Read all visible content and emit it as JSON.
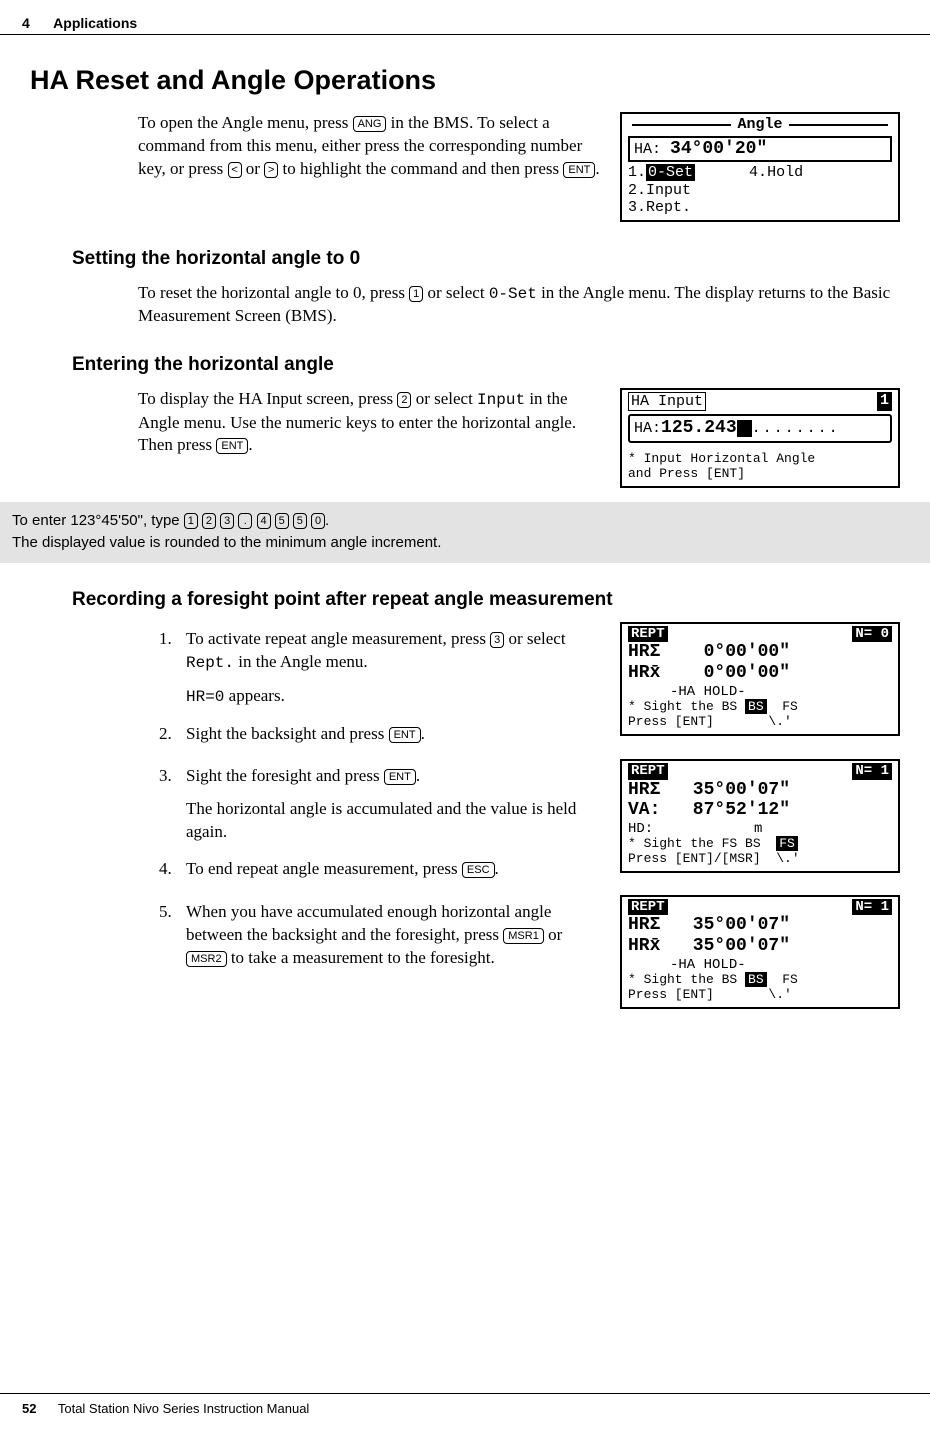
{
  "header": {
    "chapter_num": "4",
    "chapter_title": "Applications"
  },
  "footer": {
    "page_num": "52",
    "manual_title": "Total Station Nivo Series Instruction Manual"
  },
  "h1": "HA Reset and Angle Operations",
  "intro": {
    "t1": "To open the Angle menu, press ",
    "k_ang": "ANG",
    "t2": " in the BMS. To select a command from this menu, either press the corresponding number key, or press ",
    "k_left": "<",
    "t3": " or ",
    "k_right": ">",
    "t4": " to highlight the command and then press ",
    "k_ent": "ENT",
    "t5": "."
  },
  "lcd_angle": {
    "title": "Angle",
    "ha_label": "HA:",
    "ha_value": "34°00'20\"",
    "m1_num": "1.",
    "m1": "0-Set",
    "m4_num": "4.",
    "m4": "Hold",
    "m2_num": "2.",
    "m2": "Input",
    "m3_num": "3.",
    "m3": "Rept."
  },
  "sec1": {
    "h": "Setting the horizontal angle to 0",
    "p1a": "To reset the horizontal angle to 0, press ",
    "k1": "1",
    "p1b": " or select ",
    "mono": "0-Set",
    "p1c": " in the Angle menu. The display returns to the Basic Measurement Screen (BMS)."
  },
  "sec2": {
    "h": "Entering the horizontal angle",
    "p1a": "To display the HA Input screen, press ",
    "k2": "2",
    "p1b": " or select ",
    "mono": "Input",
    "p1c": " in the Angle menu. Use the numeric keys to enter the horizontal angle. Then press ",
    "k_ent": "ENT",
    "p1d": "."
  },
  "lcd_input": {
    "title": "HA Input",
    "corner": "1",
    "ha_label": "HA:",
    "ha_value": "125.243",
    "hint1": "* Input Horizontal Angle",
    "hint2": "  and Press [ENT]"
  },
  "note": {
    "line1a": "To enter 123°45'50\", type ",
    "keys": [
      "1",
      "2",
      "3",
      ".",
      "4",
      "5",
      "5",
      "0"
    ],
    "line1b": ".",
    "line2": "The displayed value is rounded to the minimum angle increment."
  },
  "sec3": {
    "h": "Recording a foresight point after repeat angle measurement",
    "step1a": "To activate repeat angle measurement, press ",
    "k3": "3",
    "step1b": " or select ",
    "mono_rept": "Rept.",
    "step1c": " in the Angle menu.",
    "step1_mono": "HR=0",
    "step1_appears": " appears.",
    "step2a": "Sight the backsight and press ",
    "k_ent": "ENT",
    "step2b": ".",
    "step3a": "Sight the foresight and press ",
    "step3b": ".",
    "step3c": "The horizontal angle is accumulated and the value is held again.",
    "step4a": "To end repeat angle measurement, press ",
    "k_esc": "ESC",
    "step4b": ".",
    "step5a": "When you have accumulated enough horizontal angle between the backsight and the foresight, press ",
    "k_msr1": "MSR1",
    "step5b": " or ",
    "k_msr2": "MSR2",
    "step5c": " to take a measurement to the foresight."
  },
  "lcd_rept1": {
    "top_left": "REPT",
    "top_right": "N= 0",
    "l1": "HRΣ    0°00'00\"",
    "l2": "HRx̄    0°00'00\"",
    "l3": "     -HA HOLD-",
    "hint1": "* Sight the BS   ",
    "bs": "BS",
    "fs": "FS",
    "hint2": "  Press [ENT]"
  },
  "lcd_rept2": {
    "top_left": "REPT",
    "top_right": "N= 1",
    "l1": "HRΣ   35°00'07\"",
    "l2": "VA:   87°52'12\"",
    "l3": "HD:            m",
    "hint1": "* Sight the FS   ",
    "bs": "BS",
    "fs": "FS",
    "hint2": "  Press [ENT]/[MSR]"
  },
  "lcd_rept3": {
    "top_left": "REPT",
    "top_right": "N= 1",
    "l1": "HRΣ   35°00'07\"",
    "l2": "HRx̄   35°00'07\"",
    "l3": "     -HA HOLD-",
    "hint1": "* Sight the BS   ",
    "bs": "BS",
    "fs": "FS",
    "hint2": "  Press [ENT]"
  }
}
